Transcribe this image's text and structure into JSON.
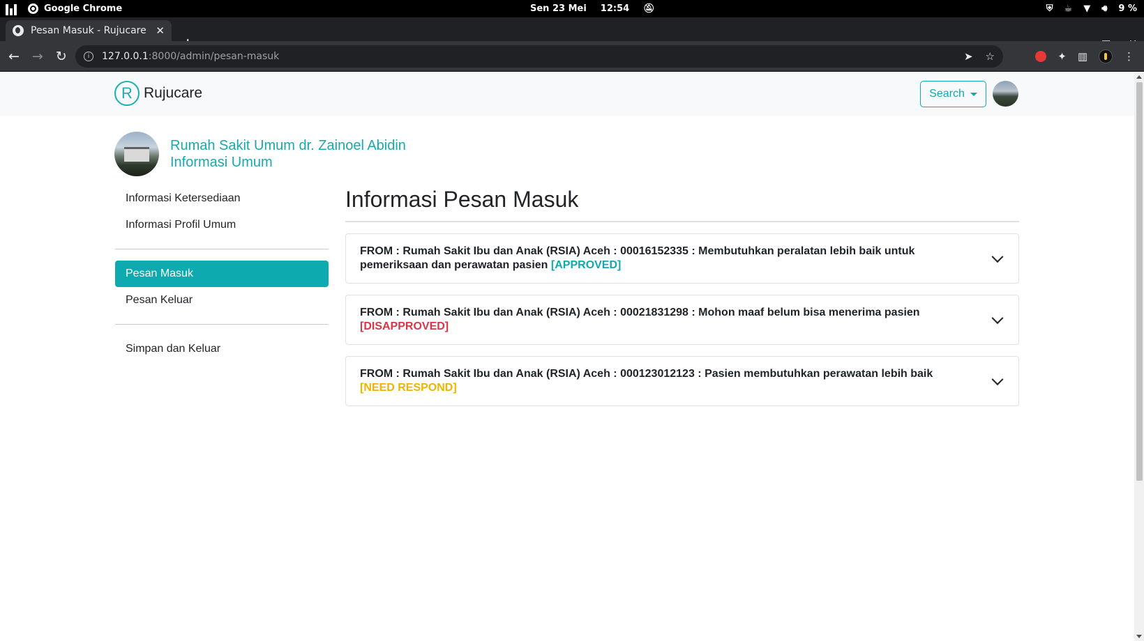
{
  "os": {
    "app_name": "Google Chrome",
    "date": "Sen 23 Mei",
    "time": "12:54",
    "battery": "9 %"
  },
  "browser": {
    "tab_title": "Pesan Masuk - Rujucare",
    "url_host": "127.0.0.1",
    "url_path": ":8000/admin/pesan-masuk"
  },
  "navbar": {
    "brand_letter": "R",
    "brand_name": "Rujucare",
    "search_label": "Search"
  },
  "hospital": {
    "name": "Rumah Sakit Umum dr. Zainoel Abidin",
    "subtitle": "Informasi Umum"
  },
  "sidebar": {
    "groups": [
      [
        "Informasi Ketersediaan",
        "Informasi Profil Umum"
      ],
      [
        "Pesan Masuk",
        "Pesan Keluar"
      ],
      [
        "Simpan dan Keluar"
      ]
    ],
    "active": "Pesan Masuk"
  },
  "main": {
    "title": "Informasi Pesan Masuk",
    "messages": [
      {
        "text": "FROM : Rumah Sakit Ibu dan Anak (RSIA) Aceh : 00016152335 : Membutuhkan peralatan lebih baik untuk pemeriksaan dan perawatan pasien",
        "status": "[APPROVED]",
        "status_color": "#0dabb0"
      },
      {
        "text": "FROM : Rumah Sakit Ibu dan Anak (RSIA) Aceh : 00021831298 : Mohon maaf belum bisa menerima pasien",
        "status": "[DISAPPROVED]",
        "status_color": "#dc3545"
      },
      {
        "text": "FROM : Rumah Sakit Ibu dan Anak (RSIA) Aceh : 000123012123 : Pasien membutuhkan perawatan lebih baik",
        "status": "[NEED RESPOND]",
        "status_color": "#f0b400"
      }
    ]
  }
}
